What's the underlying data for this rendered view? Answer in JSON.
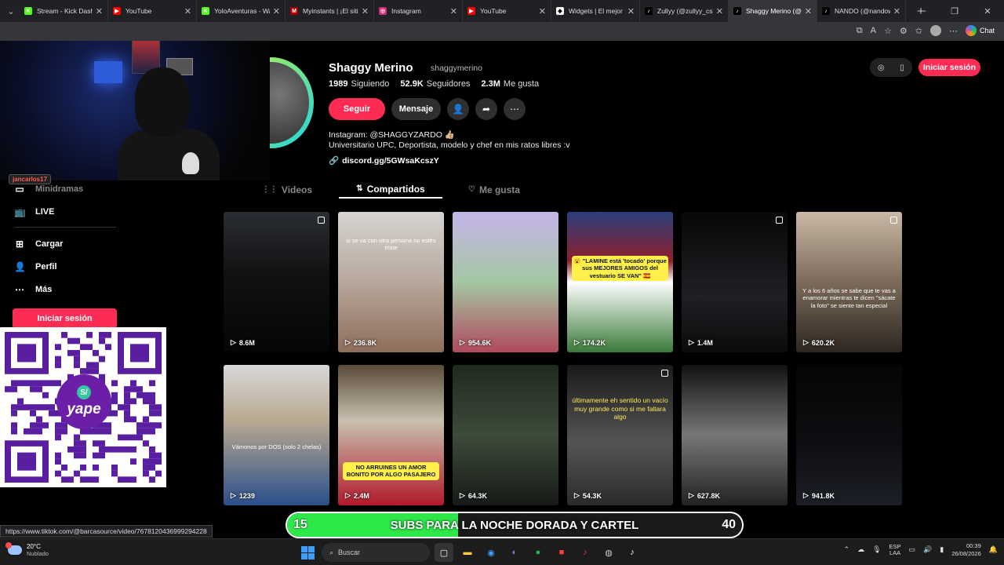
{
  "browser": {
    "tabs": [
      {
        "title": "Stream - Kick Dashbo",
        "fav_color": "#53fc18",
        "fav_glyph": "K"
      },
      {
        "title": "YouTube",
        "fav_color": "#ff0000",
        "fav_glyph": "▶"
      },
      {
        "title": "YoloAventuras - Wa",
        "fav_color": "#53fc18",
        "fav_glyph": "K"
      },
      {
        "title": "Myinstants | ¡El sitio",
        "fav_color": "#a00",
        "fav_glyph": "M"
      },
      {
        "title": "Instagram",
        "fav_color": "#d62976",
        "fav_glyph": "◎"
      },
      {
        "title": "YouTube",
        "fav_color": "#ff0000",
        "fav_glyph": "▶"
      },
      {
        "title": "Widgets | El mejor s",
        "fav_color": "#ffffff",
        "fav_glyph": "◆"
      },
      {
        "title": "Zullyy (@zullyy_cs) |",
        "fav_color": "#000",
        "fav_glyph": "♪"
      },
      {
        "title": "Shaggy Merino (@s",
        "fav_color": "#000",
        "fav_glyph": "♪"
      },
      {
        "title": "NANDO (@nandow",
        "fav_color": "#000",
        "fav_glyph": "♪"
      }
    ],
    "active_tab": 8,
    "chat_label": "Chat"
  },
  "stream": {
    "streamer_name": "jancarlos17"
  },
  "sidebar": {
    "items": [
      {
        "label": "Minidramas",
        "icon": "film-icon"
      },
      {
        "label": "LIVE",
        "icon": "live-icon"
      },
      {
        "label": "Cargar",
        "icon": "upload-icon"
      },
      {
        "label": "Perfil",
        "icon": "user-icon"
      },
      {
        "label": "Más",
        "icon": "more-icon"
      }
    ],
    "login_label": "Iniciar sesión"
  },
  "qr": {
    "brand": "yape",
    "badge": "S/"
  },
  "profile": {
    "name": "Shaggy Merino",
    "handle": "shaggymerino",
    "following": "1989",
    "following_label": "Siguiendo",
    "followers": "52.9K",
    "followers_label": "Seguidores",
    "likes": "2.3M",
    "likes_label": "Me gusta",
    "follow_label": "Seguir",
    "message_label": "Mensaje",
    "bio_line1": "Instagram: @SHAGGYZARDO 👍🏼",
    "bio_line2": "Universitario UPC, Deportista, modelo y chef en mis ratos libres :v",
    "link": "discord.gg/5GWsaKcszY",
    "top_login_label": "Iniciar sesión"
  },
  "profile_tabs": [
    {
      "label": "Videos",
      "icon": "grid-icon",
      "active": false
    },
    {
      "label": "Compartidos",
      "icon": "repost-icon",
      "active": true
    },
    {
      "label": "Me gusta",
      "icon": "heart-icon",
      "active": false
    }
  ],
  "videos": [
    {
      "views": "8.6M",
      "caption": "",
      "style": "night-plane"
    },
    {
      "views": "236.8K",
      "caption": "si se va con otra persona no estés triste",
      "style": "selfie"
    },
    {
      "views": "954.6K",
      "caption": "",
      "style": "cartoon"
    },
    {
      "views": "174.2K",
      "caption": "😮 \"LAMINE está 'tocado' porque sus MEJORES AMIGOS del vestuario SE VAN\" 🇪🇸",
      "style": "football"
    },
    {
      "views": "1.4M",
      "caption": "",
      "style": "car"
    },
    {
      "views": "620.2K",
      "caption": "Y a los 6 años se sabe que te vas a enamorar mientras te dicen \"sácate la foto\" se siente tan especial",
      "style": "kid"
    },
    {
      "views": "1239",
      "caption": "Vámonos por DOS (solo 2 chelas)",
      "style": "friends"
    },
    {
      "views": "2.4M",
      "caption": "NO ARRUINES UN AMOR BONITO POR ALGO PASAJERO",
      "style": "priest"
    },
    {
      "views": "64.3K",
      "caption": "",
      "style": "couple-plants"
    },
    {
      "views": "54.3K",
      "caption": "últimamente eh sentido un vacío muy grande como si me faltara algo",
      "style": "window"
    },
    {
      "views": "627.8K",
      "caption": "",
      "style": "bw-couple"
    },
    {
      "views": "941.8K",
      "caption": "",
      "style": "beach-night"
    }
  ],
  "status_url": "https://www.tiktok.com/@barcasource/video/7678120436999294228",
  "goal": {
    "current": "15",
    "target": "40",
    "text": "SUBS PARA LA NOCHE DORADA Y CARTEL",
    "progress": 0.375
  },
  "taskbar": {
    "temp": "20°C",
    "weather": "Nublado",
    "search_placeholder": "Buscar",
    "lang1": "ESP",
    "lang2": "LAA",
    "time": "00:39",
    "date": "26/08/2026"
  }
}
